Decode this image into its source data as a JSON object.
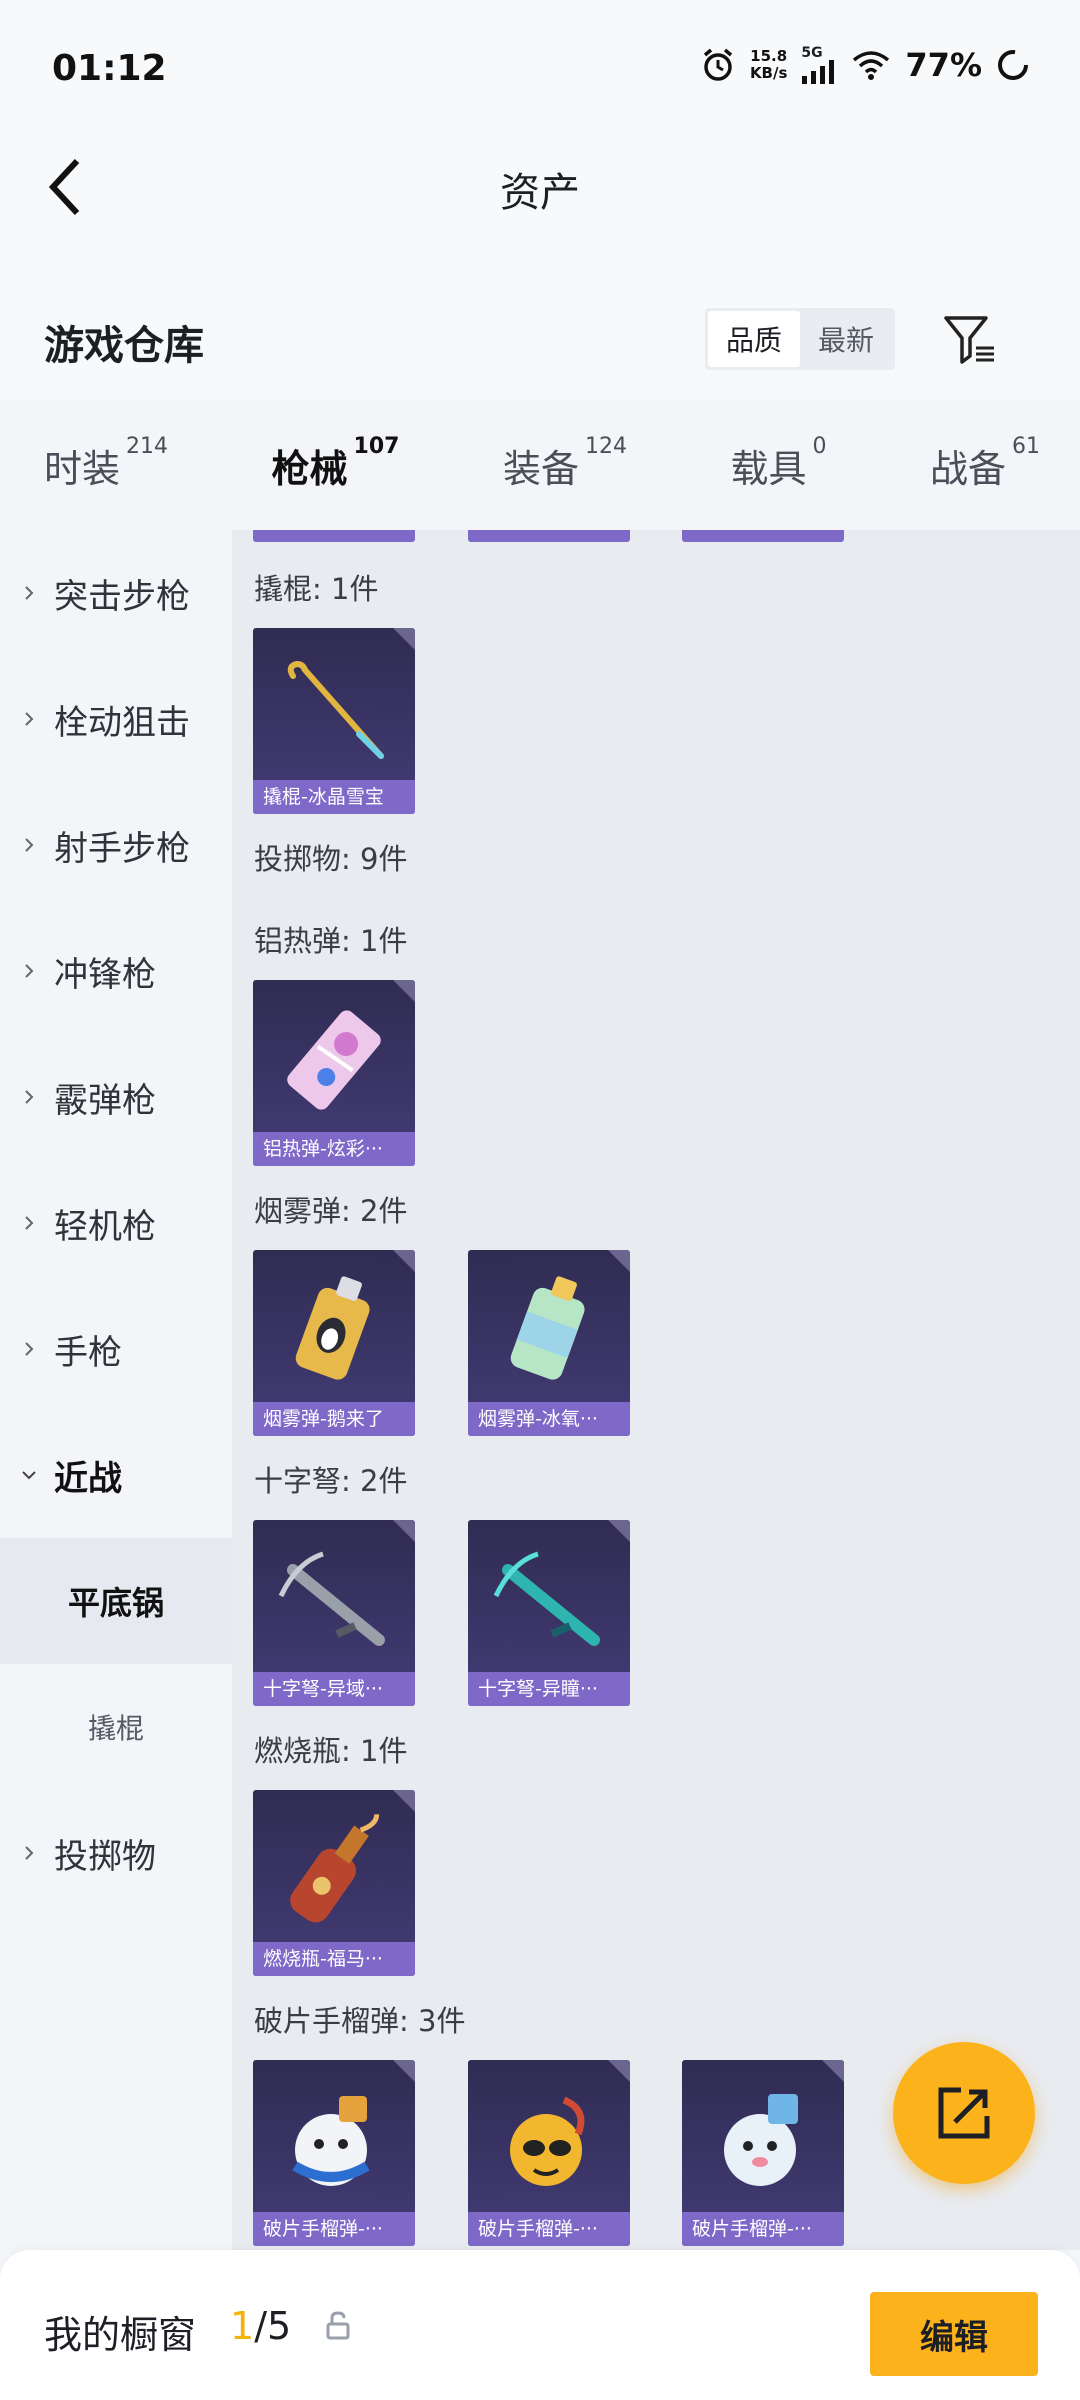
{
  "status_bar": {
    "time": "01:12",
    "net_speed_value": "15.8",
    "net_speed_unit": "KB/s",
    "network": "5G",
    "battery": "77%"
  },
  "header": {
    "title": "资产"
  },
  "section": {
    "title": "游戏仓库",
    "sort_quality": "品质",
    "sort_newest": "最新"
  },
  "tabs": [
    {
      "label": "时装",
      "count": "214"
    },
    {
      "label": "枪械",
      "count": "107"
    },
    {
      "label": "装备",
      "count": "124"
    },
    {
      "label": "载具",
      "count": "0"
    },
    {
      "label": "战备",
      "count": "61"
    }
  ],
  "sidebar": {
    "categories": [
      "突击步枪",
      "栓动狙击",
      "射手步枪",
      "冲锋枪",
      "霰弹枪",
      "轻机枪",
      "手枪",
      "近战",
      "投掷物"
    ],
    "subcategories": [
      "平底锅",
      "撬棍"
    ]
  },
  "content": {
    "groups": [
      {
        "label": "撬棍: 1件",
        "items": [
          "撬棍-冰晶雪宝"
        ]
      },
      {
        "label": "投掷物: 9件"
      },
      {
        "label": "铝热弹: 1件",
        "items": [
          "铝热弹-炫彩···"
        ]
      },
      {
        "label": "烟雾弹: 2件",
        "items": [
          "烟雾弹-鹅来了",
          "烟雾弹-冰氧···"
        ]
      },
      {
        "label": "十字弩: 2件",
        "items": [
          "十字弩-异域···",
          "十字弩-异瞳···"
        ]
      },
      {
        "label": "燃烧瓶: 1件",
        "items": [
          "燃烧瓶-福马···"
        ]
      },
      {
        "label": "破片手榴弹: 3件",
        "items": [
          "破片手榴弹-···",
          "破片手榴弹-···",
          "破片手榴弹-···"
        ]
      }
    ]
  },
  "bottom_bar": {
    "label": "我的橱窗",
    "current": "1",
    "total": "/5",
    "edit_label": "编辑"
  },
  "colors": {
    "accent": "#fbb21b",
    "card_bg": "#3b3568",
    "card_caption": "#7e68c8"
  }
}
